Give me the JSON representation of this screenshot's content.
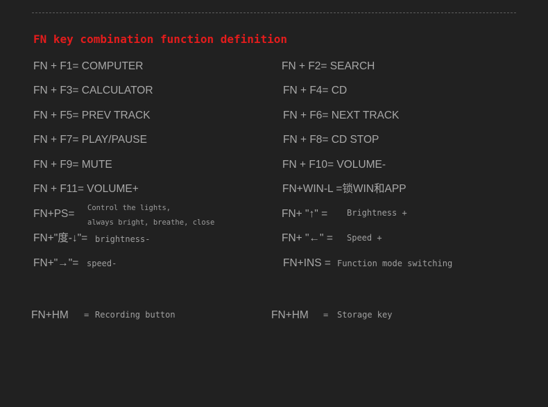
{
  "heading": "FN key combination function definition",
  "rows": [
    {
      "left": "FN + F1= COMPUTER",
      "right": "FN + F2= SEARCH"
    },
    {
      "left": "FN + F3= CALCULATOR",
      "right": "FN + F4= CD"
    },
    {
      "left": "FN + F5= PREV TRACK",
      "right": "FN + F6= NEXT TRACK"
    },
    {
      "left": "FN + F7= PLAY/PAUSE",
      "right": "FN + F8= CD STOP"
    },
    {
      "left": "FN + F9= MUTE",
      "right": "FN + F10= VOLUME-"
    },
    {
      "left": "FN + F11= VOLUME+",
      "right": "FN+WIN-L =锁WIN和APP"
    }
  ],
  "ps": {
    "key": "FN+PS=",
    "line1": "Control the lights,",
    "line2": "always bright, breathe, close"
  },
  "up": {
    "key": "FN+ \"↑\" =",
    "desc": "Brightness +"
  },
  "down": {
    "key": "FN+\"度-↓\"=",
    "desc": "brightness-"
  },
  "leftarrow": {
    "key": "FN+ \"←\" =",
    "desc": "Speed +"
  },
  "rightarrow": {
    "key": "FN+\"→\"=",
    "desc": "speed-"
  },
  "ins": {
    "key": "FN+INS =",
    "desc": "Function mode switching"
  },
  "hm1": {
    "key": "FN+HM",
    "eq": "=",
    "desc": "Recording button"
  },
  "hm2": {
    "key": "FN+HM",
    "eq": "=",
    "desc": "Storage key"
  }
}
